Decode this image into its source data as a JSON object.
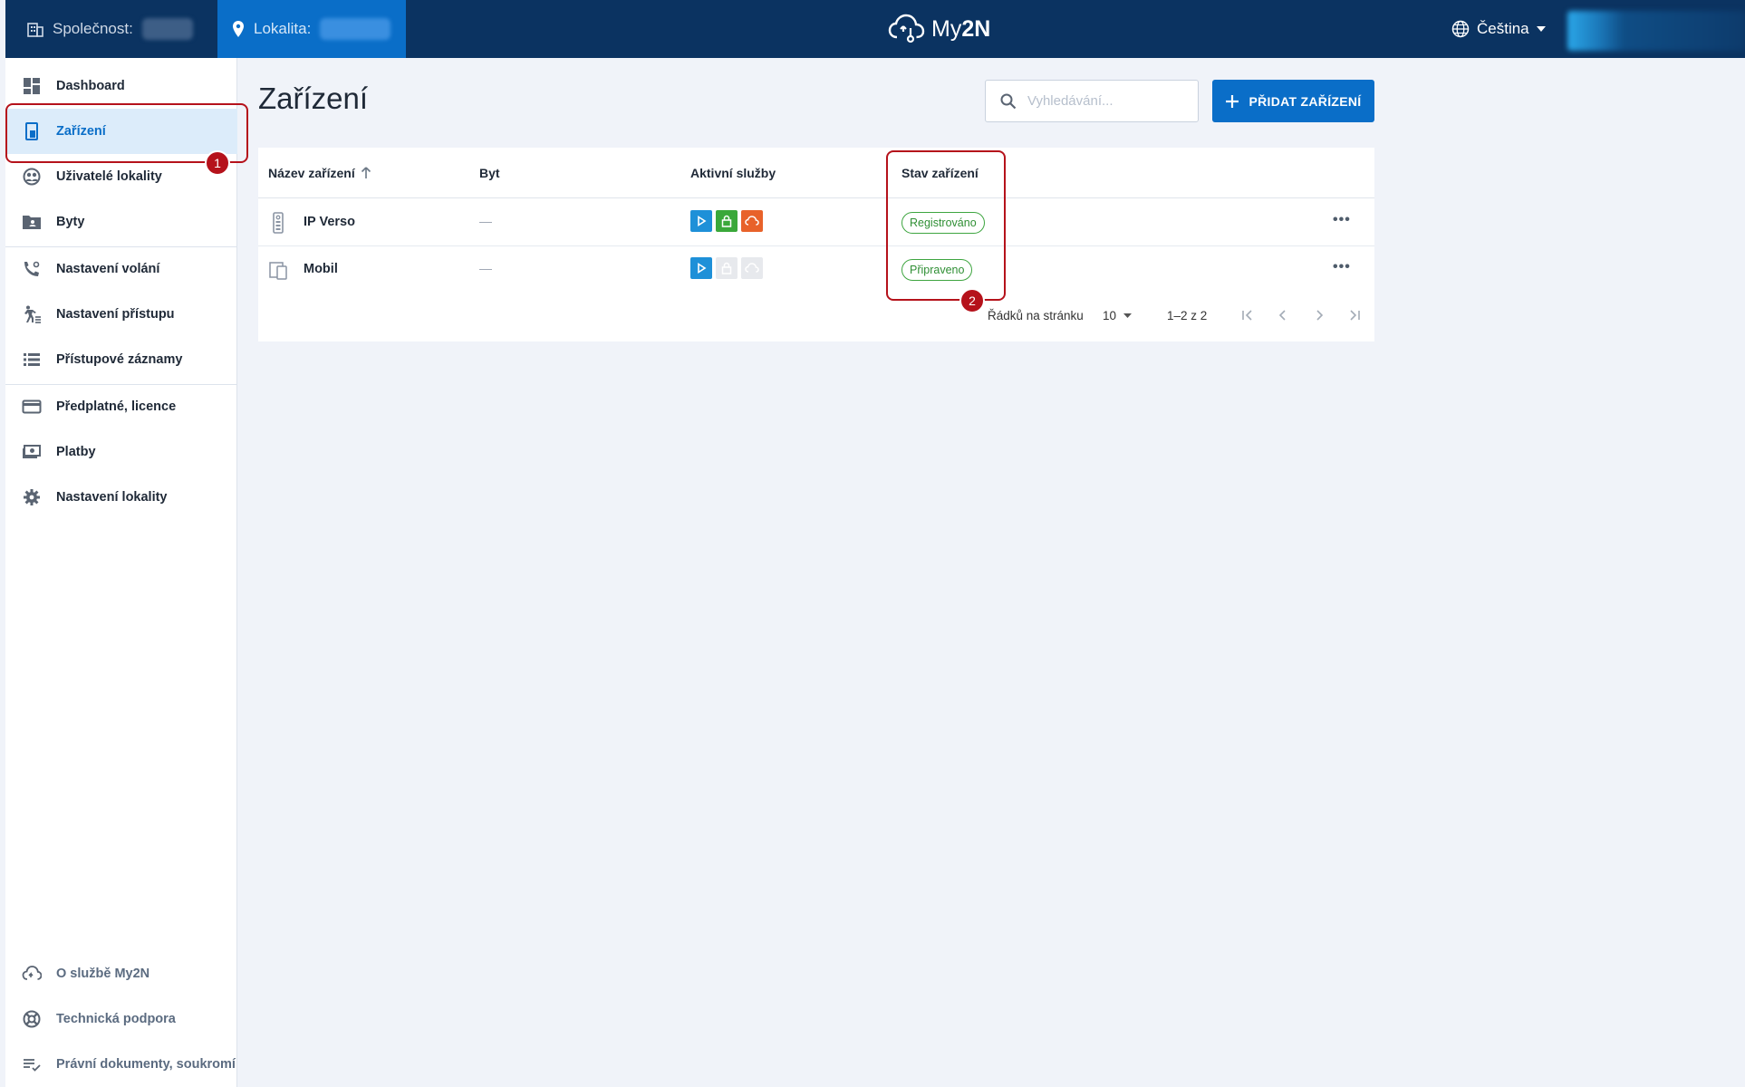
{
  "header": {
    "company_label": "Společnost:",
    "location_label": "Lokalita:",
    "logo_prefix": "My",
    "logo_bold": "2N",
    "language": "Čeština"
  },
  "sidebar": {
    "items": [
      {
        "label": "Dashboard",
        "icon": "dashboard-icon"
      },
      {
        "label": "Zařízení",
        "icon": "device-icon",
        "active": true
      },
      {
        "label": "Uživatelé lokality",
        "icon": "users-icon"
      },
      {
        "label": "Byty",
        "icon": "apartments-icon"
      },
      {
        "label": "Nastavení volání",
        "icon": "call-settings-icon"
      },
      {
        "label": "Nastavení přístupu",
        "icon": "access-icon"
      },
      {
        "label": "Přístupové záznamy",
        "icon": "access-log-icon"
      },
      {
        "label": "Předplatné, licence",
        "icon": "card-icon"
      },
      {
        "label": "Platby",
        "icon": "payments-icon"
      },
      {
        "label": "Nastavení lokality",
        "icon": "gear-icon"
      }
    ],
    "footer": [
      {
        "label": "O službě My2N",
        "icon": "cloud-icon"
      },
      {
        "label": "Technická podpora",
        "icon": "support-icon"
      },
      {
        "label": "Právní dokumenty, soukromí",
        "icon": "legal-icon"
      }
    ]
  },
  "main": {
    "title": "Zařízení",
    "search_placeholder": "Vyhledávání...",
    "add_button": "PŘIDAT ZAŘÍZENÍ",
    "columns": [
      "Název zařízení",
      "Byt",
      "Aktivní služby",
      "Stav zařízení"
    ],
    "rows": [
      {
        "name": "IP Verso",
        "byt": "—",
        "status": "Registrováno",
        "services_active": [
          true,
          true,
          true
        ]
      },
      {
        "name": "Mobil",
        "byt": "—",
        "status": "Připraveno",
        "services_active": [
          true,
          false,
          false
        ]
      }
    ],
    "more": "•••",
    "pager": {
      "rows_label": "Řádků na stránku",
      "rows_value": "10",
      "range": "1–2 z 2"
    }
  },
  "annotations": [
    "1",
    "2"
  ],
  "colors": {
    "topbar": "#0b3361",
    "accent": "#0a6ec8",
    "status_green": "#3ea540",
    "annotation_red": "#b5121b",
    "service_blue": "#1e90d8",
    "service_green": "#3aa83a",
    "service_orange": "#e8622a"
  }
}
